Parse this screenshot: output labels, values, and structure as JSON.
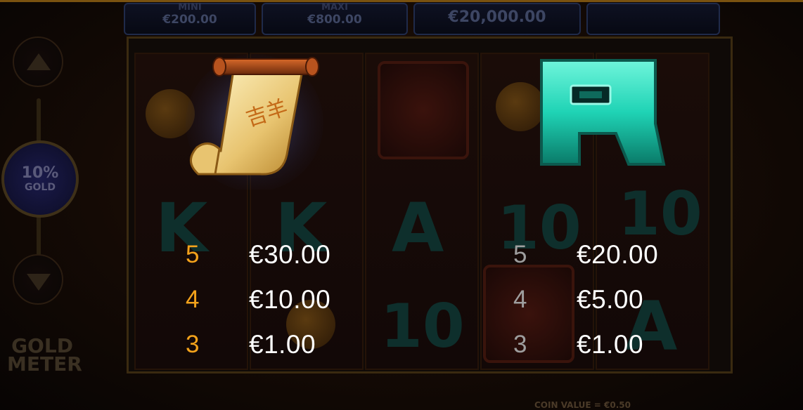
{
  "jackpots": [
    {
      "label": "MINI",
      "value": "€200.00"
    },
    {
      "label": "MAXI",
      "value": "€800.00"
    },
    {
      "label": "",
      "value": "€20,000.00"
    }
  ],
  "gold_meter": {
    "percent": "10%",
    "unit": "GOLD",
    "title_line1": "GOLD",
    "title_line2": "METER"
  },
  "coin_value": "COIN VALUE = €0.50",
  "paytable": [
    {
      "symbol": "scroll-icon",
      "count_color": "#f3a21b",
      "rows": [
        {
          "count": "5",
          "payout": "€30.00"
        },
        {
          "count": "4",
          "payout": "€10.00"
        },
        {
          "count": "3",
          "payout": "€1.00"
        }
      ]
    },
    {
      "symbol": "letter-a-icon",
      "count_color": "#9e9e9e",
      "rows": [
        {
          "count": "5",
          "payout": "€20.00"
        },
        {
          "count": "4",
          "payout": "€5.00"
        },
        {
          "count": "3",
          "payout": "€1.00"
        }
      ]
    }
  ],
  "colors": {
    "accent_orange": "#f3a21b",
    "count_grey": "#9e9e9e",
    "payout_white": "#ffffff",
    "symbol_a_teal": "#1fd3b5",
    "scroll_gold": "#e8c470"
  }
}
